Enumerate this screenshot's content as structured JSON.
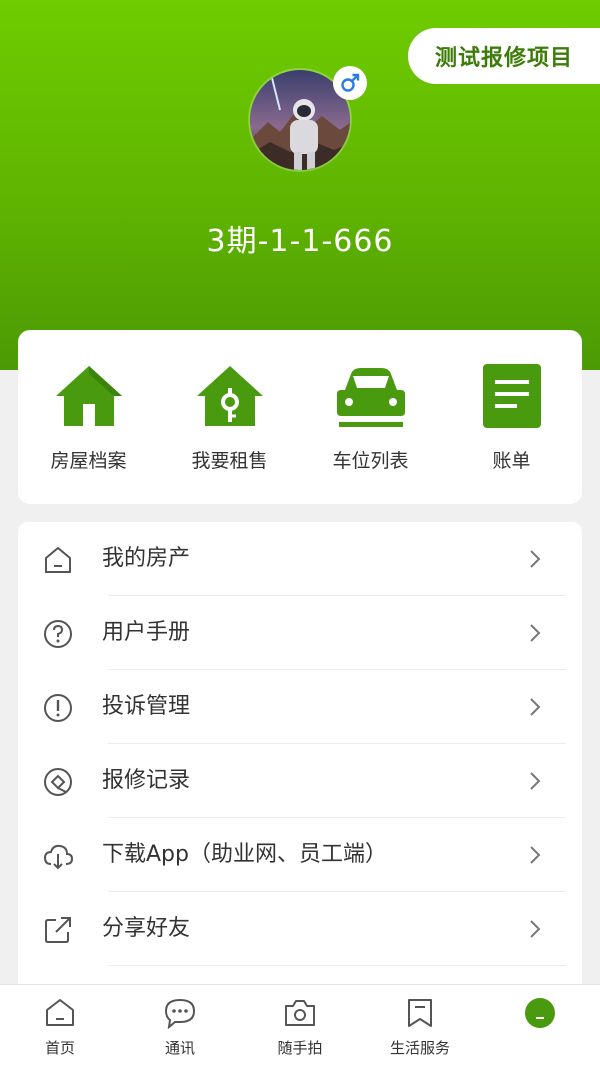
{
  "header": {
    "action_pill_label": "测试报修项目",
    "room_number": "3期-1-1-666",
    "gender_symbol": "♂"
  },
  "quick_actions": [
    {
      "label": "房屋档案",
      "icon": "house-icon"
    },
    {
      "label": "我要租售",
      "icon": "house-key-icon"
    },
    {
      "label": "车位列表",
      "icon": "car-icon"
    },
    {
      "label": "账单",
      "icon": "bill-icon"
    }
  ],
  "menu": [
    {
      "label": "我的房产",
      "icon": "home-outline-icon"
    },
    {
      "label": "用户手册",
      "icon": "question-circle-icon"
    },
    {
      "label": "投诉管理",
      "icon": "exclamation-circle-icon"
    },
    {
      "label": "报修记录",
      "icon": "repair-record-icon"
    },
    {
      "label": "下载App（助业网、员工端）",
      "icon": "cloud-download-icon"
    },
    {
      "label": "分享好友",
      "icon": "share-icon"
    }
  ],
  "tabbar": [
    {
      "label": "首页",
      "icon": "home-tab-icon"
    },
    {
      "label": "通讯",
      "icon": "chat-icon"
    },
    {
      "label": "随手拍",
      "icon": "camera-icon"
    },
    {
      "label": "生活服务",
      "icon": "bookmark-icon"
    },
    {
      "label": "",
      "icon": "profile-tab-icon"
    }
  ],
  "colors": {
    "brand_green": "#5fb400",
    "icon_green": "#4a9a10"
  }
}
